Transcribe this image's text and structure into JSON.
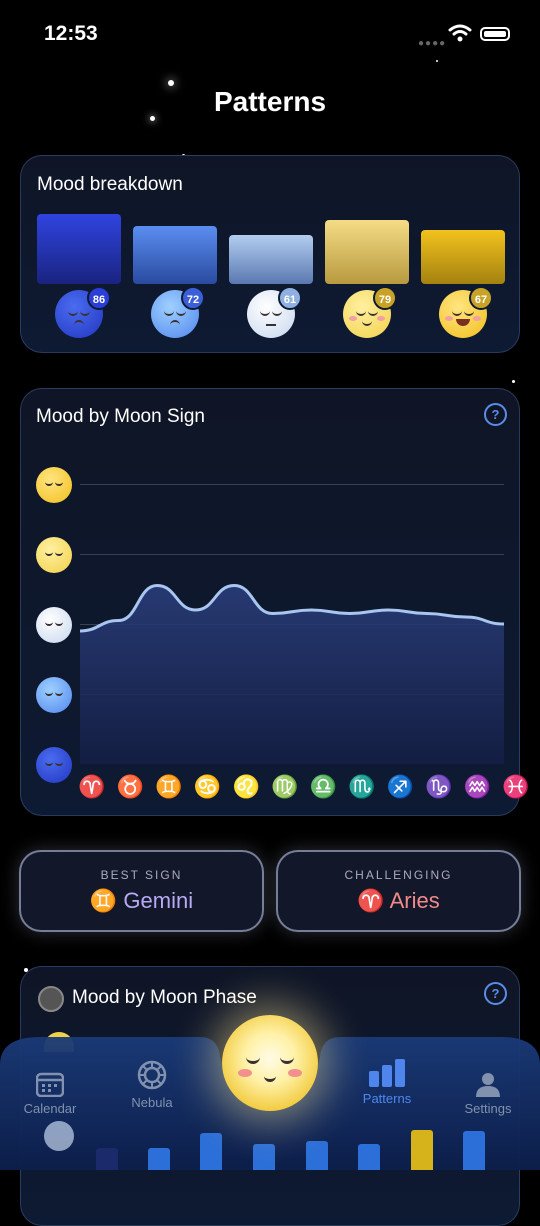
{
  "status": {
    "time": "12:53"
  },
  "page_title": "Patterns",
  "mood_breakdown": {
    "title": "Mood breakdown",
    "items": [
      {
        "mood": "very-sad",
        "count": "86",
        "color": "#2b3fd8"
      },
      {
        "mood": "sad",
        "count": "72",
        "color": "#4f86ee"
      },
      {
        "mood": "neutral",
        "count": "61",
        "color": "#a9c6ea"
      },
      {
        "mood": "happy",
        "count": "79",
        "color": "#f1d26b"
      },
      {
        "mood": "very-happy",
        "count": "67",
        "color": "#e9b817"
      }
    ]
  },
  "moon_sign": {
    "title": "Mood by Moon Sign",
    "help": "?",
    "signs": [
      "♈",
      "♉",
      "♊",
      "♋",
      "♌",
      "♍",
      "♎",
      "♏",
      "♐",
      "♑",
      "♒",
      "♓"
    ],
    "sign_colors": [
      "#e0677c",
      "#5dbb73",
      "#8e8cd8",
      "#5b8de8",
      "#e0677c",
      "#5dbb73",
      "#8e8cd8",
      "#5b8de8",
      "#e0677c",
      "#5dbb73",
      "#8e8cd8",
      "#5b8de8"
    ]
  },
  "chart_data": {
    "type": "area",
    "title": "Mood by Moon Sign",
    "categories": [
      "Aries",
      "Taurus",
      "Gemini",
      "Cancer",
      "Leo",
      "Virgo",
      "Libra",
      "Scorpio",
      "Sagittarius",
      "Capricorn",
      "Aquarius",
      "Pisces"
    ],
    "series": [
      {
        "values": [
          2.9,
          3.05,
          3.55,
          3.2,
          3.55,
          3.15,
          3.2,
          3.15,
          3.2,
          3.15,
          3.1,
          3.0
        ]
      }
    ],
    "ylim": [
      1,
      5
    ],
    "y_levels": [
      "very-sad",
      "sad",
      "neutral",
      "happy",
      "very-happy"
    ]
  },
  "best_sign": {
    "label": "BEST SIGN",
    "value": "♊ Gemini"
  },
  "challenging": {
    "label": "CHALLENGING",
    "value": "♈ Aries"
  },
  "moon_phase": {
    "title": "Mood by Moon Phase",
    "help": "?"
  },
  "tabs": [
    {
      "label": "Calendar"
    },
    {
      "label": "Nebula"
    },
    {
      "label": "Patterns"
    },
    {
      "label": "Settings"
    }
  ]
}
